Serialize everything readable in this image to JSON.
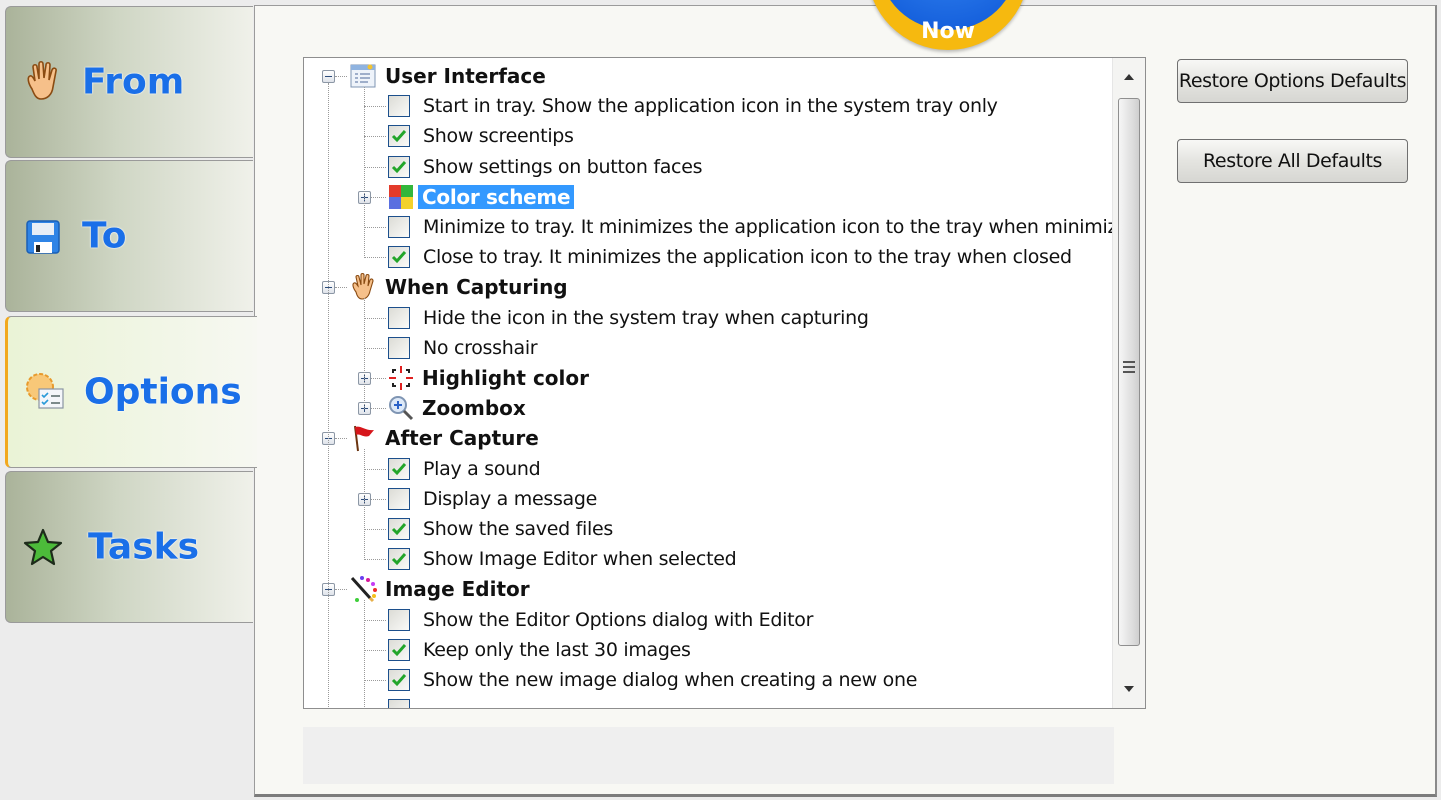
{
  "tabs": [
    {
      "label": "From",
      "icon": "hand-icon",
      "active": false
    },
    {
      "label": "To",
      "icon": "floppy-disk-icon",
      "active": false
    },
    {
      "label": "Options",
      "icon": "options-gear-checklist-icon",
      "active": true
    },
    {
      "label": "Tasks",
      "icon": "star-icon",
      "active": false
    }
  ],
  "badge": {
    "text": "Now"
  },
  "buttons": {
    "restore_options": "Restore Options Defaults",
    "restore_all": "Restore All Defaults"
  },
  "tree": {
    "groups": [
      {
        "label": "User Interface",
        "icon": "window-icon",
        "expanded": true,
        "items": [
          {
            "type": "check",
            "label": "Start in tray. Show the application icon in the system tray only",
            "checked": false
          },
          {
            "type": "check",
            "label": "Show screentips",
            "checked": true
          },
          {
            "type": "check",
            "label": "Show settings on button faces",
            "checked": true
          },
          {
            "type": "node",
            "label": "Color scheme",
            "icon": "color-scheme-icon",
            "selected": true,
            "expandable": true
          },
          {
            "type": "check",
            "label": "Minimize to tray. It minimizes the application icon to the tray when minimized",
            "checked": false
          },
          {
            "type": "check",
            "label": "Close to tray. It minimizes the application icon to the tray when closed",
            "checked": true
          }
        ]
      },
      {
        "label": "When Capturing",
        "icon": "hand-icon",
        "expanded": true,
        "items": [
          {
            "type": "check",
            "label": "Hide the icon in the system tray when capturing",
            "checked": false
          },
          {
            "type": "check",
            "label": "No crosshair",
            "checked": false
          },
          {
            "type": "node",
            "label": "Highlight color",
            "icon": "crosshair-icon",
            "bold": true,
            "expandable": true
          },
          {
            "type": "node",
            "label": "Zoombox",
            "icon": "magnifier-icon",
            "bold": true,
            "expandable": true
          }
        ]
      },
      {
        "label": "After Capture",
        "icon": "red-flag-icon",
        "expanded": true,
        "items": [
          {
            "type": "check",
            "label": "Play a sound",
            "checked": true
          },
          {
            "type": "check",
            "label": "Display a message",
            "checked": false,
            "expandable": true
          },
          {
            "type": "check",
            "label": "Show the saved files",
            "checked": true
          },
          {
            "type": "check",
            "label": "Show Image Editor when selected",
            "checked": true
          }
        ]
      },
      {
        "label": "Image Editor",
        "icon": "pencil-palette-icon",
        "expanded": true,
        "items": [
          {
            "type": "check",
            "label": "Show the Editor Options dialog with Editor",
            "checked": false
          },
          {
            "type": "check",
            "label": "Keep only the last 30 images",
            "checked": true
          },
          {
            "type": "check",
            "label": "Show the new image dialog when creating a new one",
            "checked": true
          },
          {
            "type": "check",
            "label": "",
            "checked": false,
            "clipped": true
          }
        ]
      }
    ]
  },
  "colors": {
    "tab_text": "#1a6fe8",
    "selection": "#3399ff",
    "active_tab_accent": "#f2a81d",
    "check": "#22a52a"
  }
}
